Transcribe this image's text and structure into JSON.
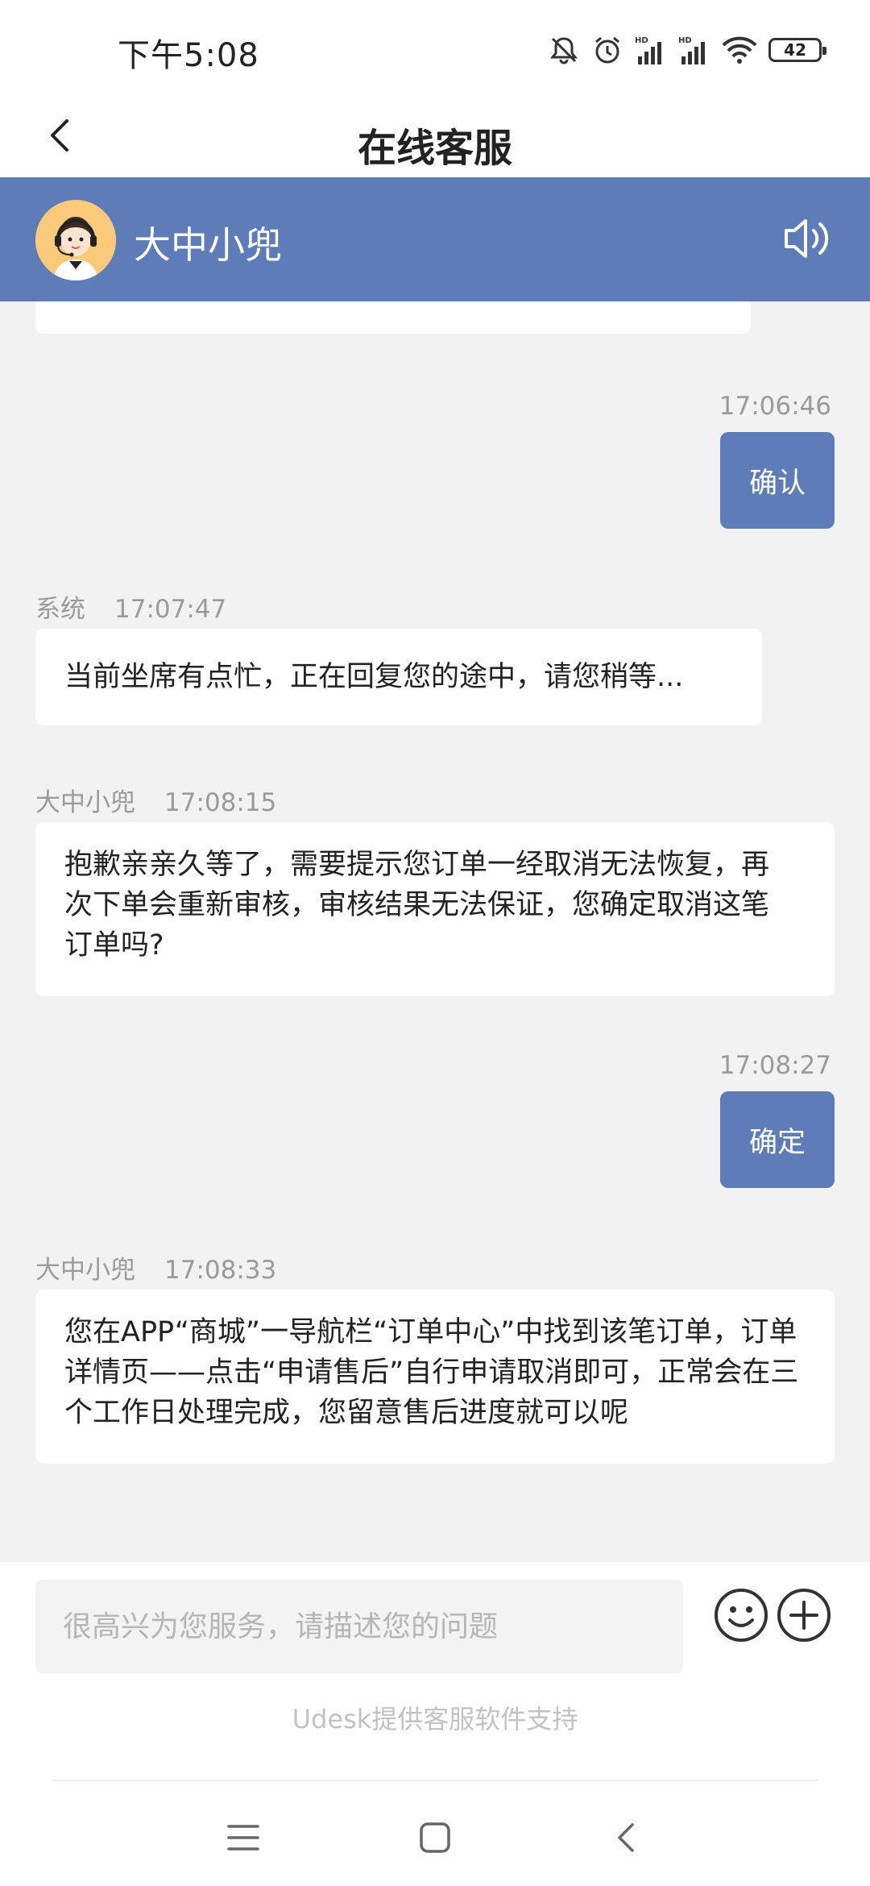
{
  "status_bar": {
    "time": "下午5:08",
    "battery": "42"
  },
  "header": {
    "title": "在线客服"
  },
  "agent": {
    "name": "大中小兜"
  },
  "messages": [
    {
      "side": "right",
      "time": "17:06:46",
      "text": "确认"
    },
    {
      "side": "left",
      "sender": "系统",
      "time": "17:07:47",
      "text": "当前坐席有点忙，正在回复您的途中，请您稍等..."
    },
    {
      "side": "left",
      "sender": "大中小兜",
      "time": "17:08:15",
      "lines": [
        "抱歉亲亲久等了，需要提示您订单一经取消无法恢复，再",
        "次下单会重新审核，审核结果无法保证，您确定取消这笔",
        "订单吗?"
      ]
    },
    {
      "side": "right",
      "time": "17:08:27",
      "text": "确定"
    },
    {
      "side": "left",
      "sender": "大中小兜",
      "time": "17:08:33",
      "lines": [
        "您在APP“商城”一导航栏“订单中心”中找到该笔订单，订单",
        "详情页——点击“申请售后”自行申请取消即可，正常会在三",
        "个工作日处理完成，您留意售后进度就可以呢"
      ]
    }
  ],
  "input": {
    "value": "",
    "placeholder": "很高兴为您服务，请描述您的问题"
  },
  "footer": {
    "powered_by": "Udesk提供客服软件支持"
  },
  "colors": {
    "accent": "#5e7cb8",
    "chat_background": "#f2f2f2",
    "bubble_left": "#ffffff"
  },
  "icons": [
    "mute-icon",
    "alarm-icon",
    "signal-icon",
    "wifi-icon",
    "battery-icon",
    "back-arrow-icon",
    "agent-avatar",
    "speaker-icon",
    "emoji-icon",
    "plus-icon",
    "menu-icon",
    "home-icon",
    "nav-back-icon"
  ]
}
